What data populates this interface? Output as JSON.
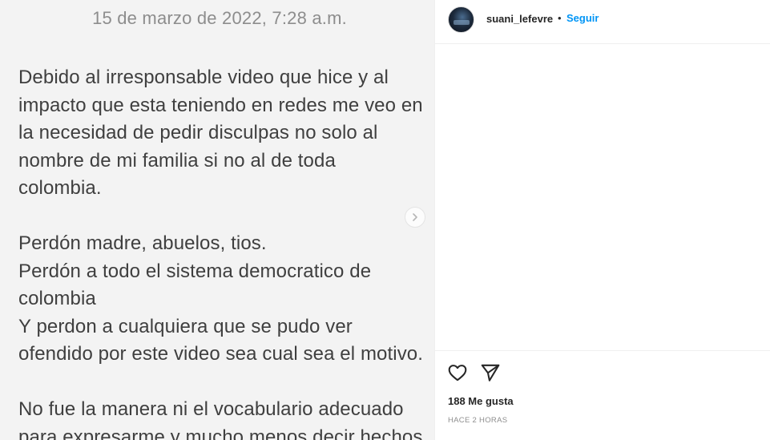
{
  "post": {
    "date_line": "15 de marzo de 2022, 7:28 a.m.",
    "note_text": "Debido al irresponsable video que hice y al\nimpacto que esta teniendo en redes me veo en\nla necesidad de pedir disculpas  no solo al\nnombre de mi familia si no al de toda\ncolombia.\n\nPerdón madre, abuelos, tios.\nPerdón a todo el sistema democratico de\ncolombia\nY perdon a cualquiera que se pudo ver\nofendido por este video sea cual sea el motivo.\n\nNo fue la manera ni el vocabulario adecuado\npara expresarme y mucho menos decir hechos",
    "next_icon": "chevron-right-icon"
  },
  "header": {
    "username": "suani_lefevre",
    "separator": "•",
    "follow_label": "Seguir"
  },
  "actions": {
    "like_icon": "heart-icon",
    "share_icon": "paper-plane-icon",
    "likes_text": "188 Me gusta",
    "time_text": "HACE 2 HORAS"
  },
  "colors": {
    "accent": "#0095f6",
    "text": "#262626",
    "muted": "#8e8e8e",
    "note_bg": "#f3f3f3"
  }
}
